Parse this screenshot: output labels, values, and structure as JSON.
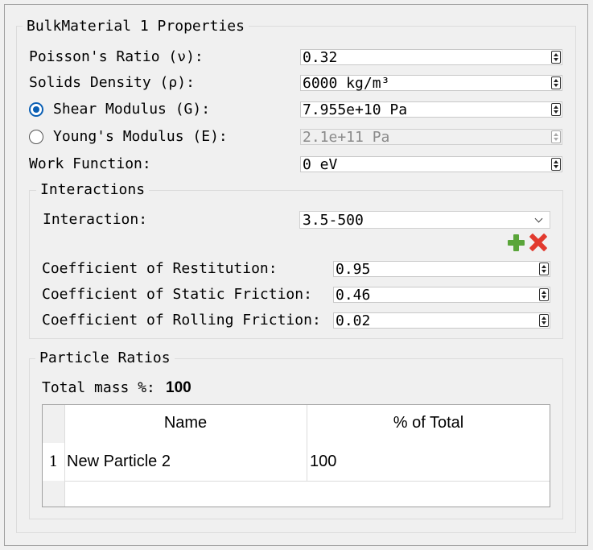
{
  "group_title": "BulkMaterial 1 Properties",
  "properties": {
    "poisson_label": "Poisson's Ratio (ν):",
    "poisson_value": "0.32",
    "density_label": "Solids Density (ρ):",
    "density_value": "6000 kg/m³",
    "shear_label": "Shear Modulus (G):",
    "shear_value": "7.955e+10 Pa",
    "shear_selected": true,
    "young_label": "Young's Modulus (E):",
    "young_value": "2.1e+11 Pa",
    "young_selected": false,
    "work_label": "Work Function:",
    "work_value": "0 eV"
  },
  "interactions": {
    "title": "Interactions",
    "interaction_label": "Interaction:",
    "interaction_value": "3.5-500",
    "restitution_label": "Coefficient of Restitution:",
    "restitution_value": "0.95",
    "static_label": "Coefficient of Static Friction:",
    "static_value": "0.46",
    "rolling_label": "Coefficient of Rolling Friction:",
    "rolling_value": "0.02",
    "add_icon": "plus-icon",
    "remove_icon": "x-icon",
    "add_color": "#5aa53a",
    "remove_color": "#e23a2e"
  },
  "particle_ratios": {
    "title": "Particle Ratios",
    "total_label": "Total mass %:",
    "total_value": "100",
    "columns": [
      "Name",
      "% of Total"
    ],
    "rows": [
      {
        "index": "1",
        "name": "New Particle 2",
        "percent": "100"
      }
    ]
  },
  "colors": {
    "accent": "#0a5fb4",
    "background": "#f0f0f0"
  }
}
